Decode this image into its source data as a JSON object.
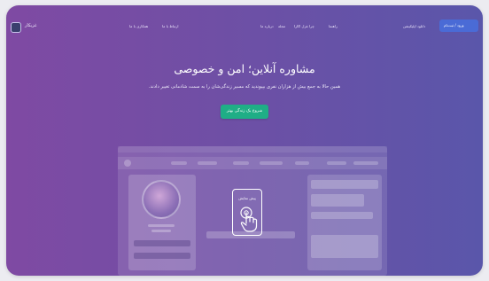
{
  "nav": {
    "brand": "غزیکار",
    "links_left": [
      "همکاری با ما",
      "ارتباط با ما"
    ],
    "links_right": [
      "درباره ما",
      "مجله",
      "چرا غزل اکارا",
      "راهنما"
    ],
    "login_label": "ورود / ثبت‌نام",
    "download_label": "دانلود اپلیکیشن"
  },
  "hero": {
    "title": "مشاوره آنلاین؛ امن و خصوصی",
    "subtitle": "همین حالا به جمع بیش از هزاران نفری بپیوندید که مسیر زندگی‌شان را به سمت شادمانی تغییر دادند.",
    "cta_label": "شروع یک زندگی بهتر"
  },
  "demo": {
    "label": "پیش نمایش",
    "icon": "tap-hand-icon"
  },
  "colors": {
    "gradient_left": "#7f4aa3",
    "gradient_right": "#5a56aa",
    "cta": "#1fae86",
    "login": "#4a6bd6"
  }
}
